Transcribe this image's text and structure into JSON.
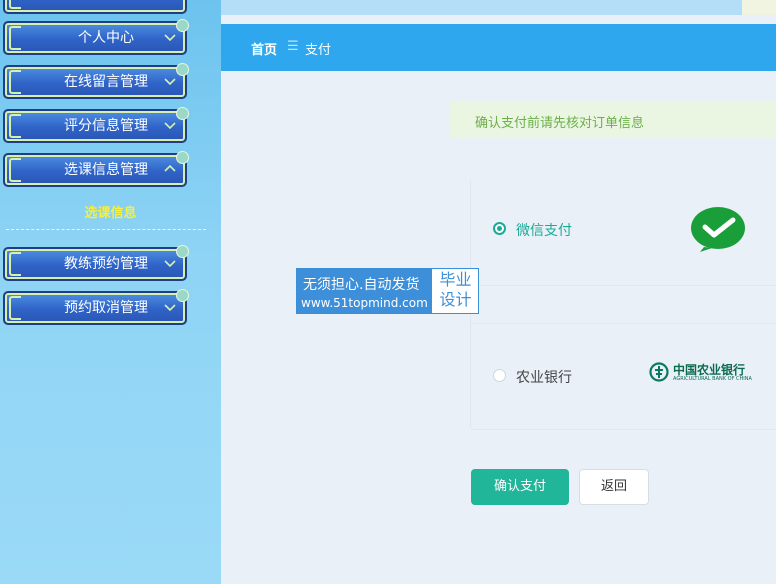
{
  "sidebar": {
    "items": [
      {
        "label": ""
      },
      {
        "label": "个人中心"
      },
      {
        "label": "在线留言管理"
      },
      {
        "label": "评分信息管理"
      },
      {
        "label": "选课信息管理"
      },
      {
        "label": "教练预约管理"
      },
      {
        "label": "预约取消管理"
      }
    ],
    "sub_item": "选课信息"
  },
  "breadcrumb": {
    "home": "首页",
    "separator": "☰",
    "current": "支付"
  },
  "notice": "确认支付前请先核对订单信息",
  "payment": {
    "options": [
      {
        "label": "微信支付",
        "selected": true,
        "icon": "wechat-pay-logo"
      },
      {
        "label": "农业银行",
        "selected": false,
        "icon": "abc-bank-logo",
        "logo_text_cn": "中国农业银行",
        "logo_text_en": "AGRICULTURAL BANK OF CHINA"
      }
    ]
  },
  "watermark": {
    "line1": "无须担心.自动发货",
    "line2": "www.51topmind.com",
    "side": "毕业设计"
  },
  "buttons": {
    "confirm": "确认支付",
    "back": "返回"
  },
  "colors": {
    "accent": "#21b69a",
    "header_bar": "#2ea7ee",
    "sidebar_sub": "#f5ef40"
  }
}
